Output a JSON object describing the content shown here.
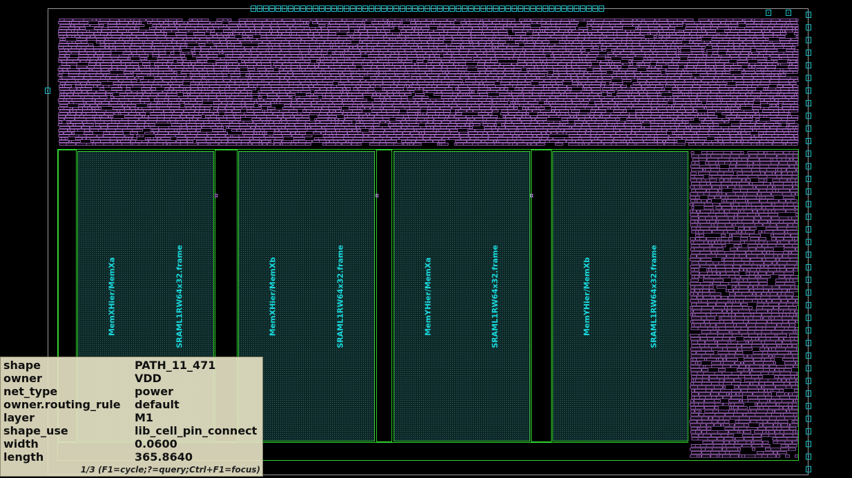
{
  "macros": [
    {
      "instance": "MemXHier/MemXa",
      "master": "SRAML1RW64x32.frame"
    },
    {
      "instance": "MemXHier/MemXb",
      "master": "SRAML1RW64x32.frame"
    },
    {
      "instance": "MemYHier/MemXa",
      "master": "SRAML1RW64x32.frame"
    },
    {
      "instance": "MemYHier/MemXb",
      "master": "SRAML1RW64x32.frame"
    }
  ],
  "query_panel": {
    "rows": [
      {
        "key": "shape",
        "value": "PATH_11_471"
      },
      {
        "key": "owner",
        "value": "VDD"
      },
      {
        "key": "net_type",
        "value": "power"
      },
      {
        "key": "owner.routing_rule",
        "value": "default"
      },
      {
        "key": "layer",
        "value": "M1"
      },
      {
        "key": "shape_use",
        "value": "lib_cell_pin_connect"
      },
      {
        "key": "width",
        "value": "0.0600"
      },
      {
        "key": "length",
        "value": "365.8640"
      }
    ],
    "status": "1/3 (F1=cycle;?=query;Ctrl+F1=focus)"
  },
  "colors": {
    "background": "#000000",
    "die_outline": "#9a9a9a",
    "core_outline": "#2fd12f",
    "std_cells": "#c27ae8",
    "macro_fill": "#0f2e2e",
    "macro_label": "#19d8dc",
    "io_pin": "#19c8d0"
  }
}
